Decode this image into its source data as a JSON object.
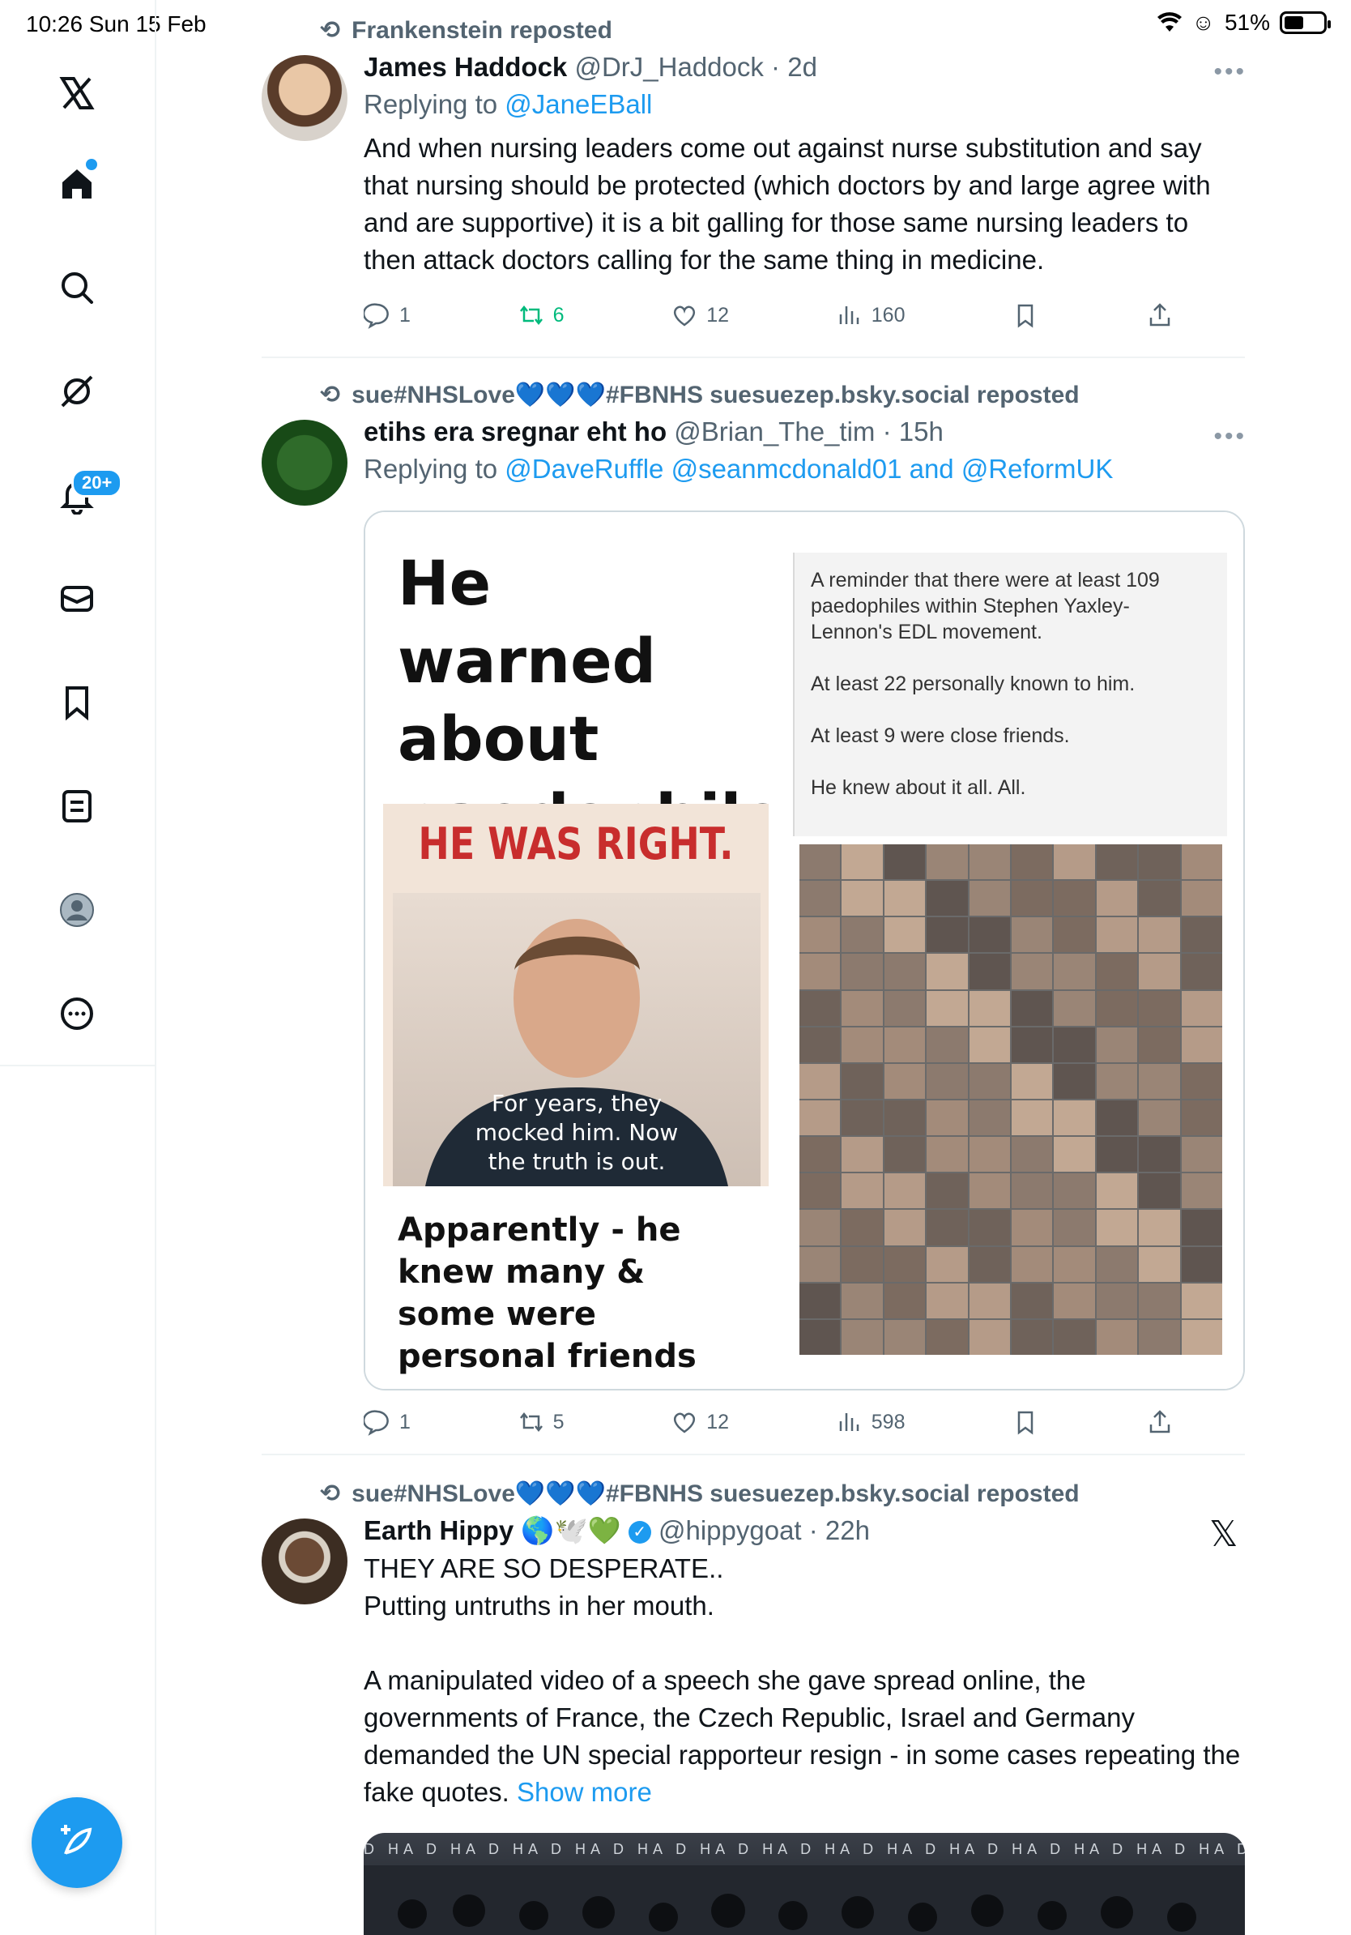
{
  "status_bar": {
    "time_date": "10:26  Sun 15 Feb",
    "battery": "51%",
    "battery_level": 0.51
  },
  "sidebar": {
    "items": [
      {
        "icon": "x-logo-icon"
      },
      {
        "icon": "home-icon"
      },
      {
        "icon": "search-icon"
      },
      {
        "icon": "grok-icon"
      },
      {
        "icon": "notifications-icon"
      },
      {
        "icon": "messages-icon"
      },
      {
        "icon": "bookmarks-icon"
      },
      {
        "icon": "lists-icon"
      },
      {
        "icon": "profile-icon"
      },
      {
        "icon": "more-icon"
      }
    ],
    "notifications_badge": "20+",
    "compose_icon": "compose-icon"
  },
  "posts": [
    {
      "reposted_by": "Frankenstein reposted",
      "name": "James Haddock",
      "handle": "@DrJ_Haddock",
      "time": "2d",
      "replying_prefix": "Replying to ",
      "replying_to": "@JaneEBall",
      "text": "And when nursing leaders come out against nurse substitution and say that nursing should be protected (which doctors by and large agree with and are supportive) it is a bit galling for those same nursing leaders to then attack doctors calling for the same thing in medicine.",
      "replies": "1",
      "reposts": "6",
      "likes": "12",
      "views": "160"
    },
    {
      "reposted_by": "sue#NHSLove💙💙💙#FBNHS suesuezep.bsky.social reposted",
      "name": "etihs era sregnar eht ho",
      "handle": "@Brian_The_tim",
      "time": "15h",
      "replying_prefix": "Replying to ",
      "replying_to": "@DaveRuffle @seanmcdonald01 and @ReformUK",
      "media": {
        "title": "He warned about paedophiles",
        "banner": "HE WAS RIGHT.",
        "caption": "For years, they mocked him. Now the truth is out.",
        "subtitle": "Apparently - he knew many & some were personal friends",
        "box_lines": [
          "A reminder that there were at least 109 paedophiles within Stephen Yaxley-Lennon's EDL movement.",
          "At least 22 personally known to him.",
          "At least 9 were close friends.",
          "He knew about it all. All."
        ]
      },
      "replies": "1",
      "reposts": "5",
      "likes": "12",
      "views": "598"
    },
    {
      "reposted_by": "sue#NHSLove💙💙💙#FBNHS suesuezep.bsky.social reposted",
      "name": "Earth Hippy 🌎🕊️💚",
      "handle": "@hippygoat",
      "time": "22h",
      "text": "THEY ARE SO DESPERATE..\nPutting untruths in her mouth.\n\nA manipulated video of a speech she gave spread online, the governments of France, the Czech Republic, Israel and Germany demanded the UN special rapporteur resign - in some cases repeating the fake quotes. ",
      "show_more": "Show more",
      "video_strip": "D HA  D HA  D HA  D HA  D HA  D HA  D HA  D HA  D HA  D HA  D HA  D HA  D HA  D HA  D HA  D HA  D HA"
    }
  ],
  "colors": {
    "accent": "#1d9bf0",
    "repost_green": "#00ba7c",
    "muted": "#536471"
  }
}
